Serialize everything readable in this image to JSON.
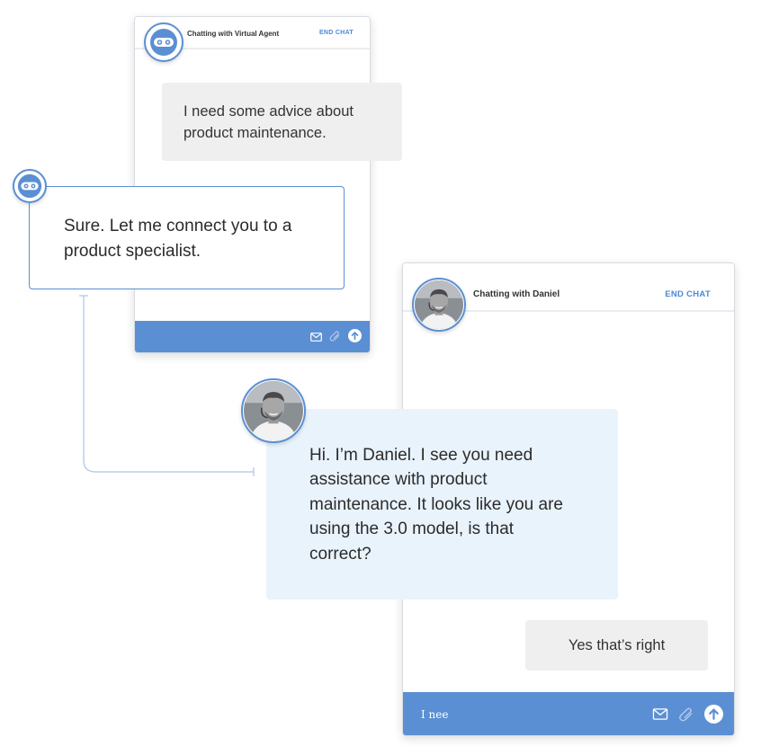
{
  "agent_window": {
    "title": "Chatting with Virtual Agent",
    "end_chat": "END CHAT",
    "footer_icons": [
      "mail-icon",
      "paperclip-icon",
      "send-arrow-icon"
    ]
  },
  "daniel_window": {
    "title": "Chatting with Daniel",
    "end_chat": "END CHAT",
    "input_value": "I nee",
    "footer_icons": [
      "mail-icon",
      "paperclip-icon",
      "send-arrow-icon"
    ]
  },
  "messages": {
    "user_1": "I need some advice about product maintenance.",
    "agent_1": "Sure. Let me connect you to a product specialist.",
    "daniel_1": "Hi. I’m Daniel. I see you need assistance with product maintenance. It looks like you are using the 3.0 model, is that correct?",
    "user_2": "Yes that’s right"
  },
  "colors": {
    "accent": "#5b8fd3",
    "end_chat": "#4a8ad4",
    "user_bubble": "#efefef",
    "daniel_bubble": "#e9f3fc"
  }
}
